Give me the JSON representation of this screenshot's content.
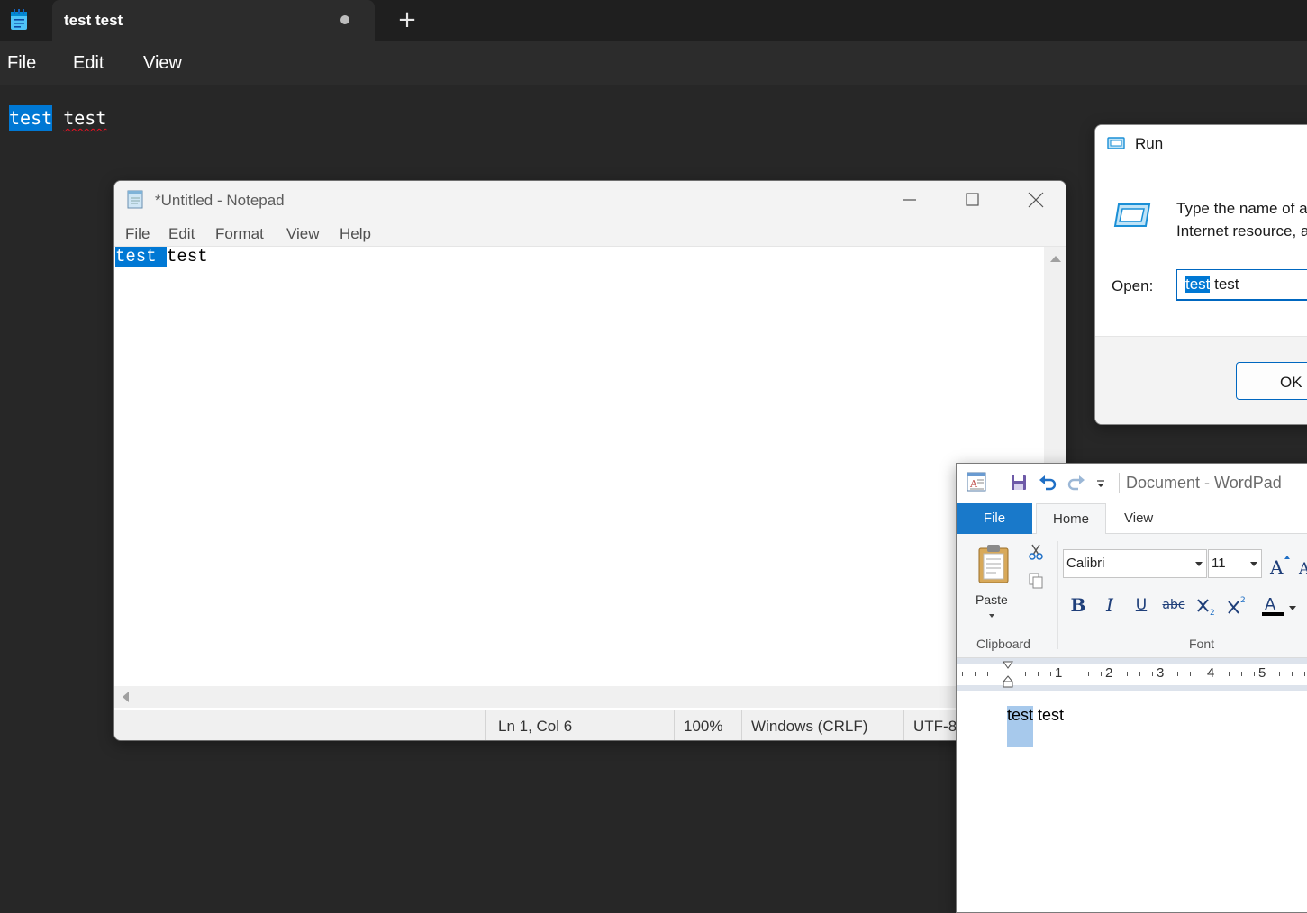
{
  "bg_notepad": {
    "tab_title": "test test",
    "menu": [
      "File",
      "Edit",
      "View"
    ],
    "text_selected": "test",
    "text_rest": "test"
  },
  "notepad": {
    "title": "*Untitled - Notepad",
    "menu": [
      "File",
      "Edit",
      "Format",
      "View",
      "Help"
    ],
    "text_selected": "test ",
    "text_rest": "test",
    "status": {
      "position": "Ln 1, Col 6",
      "zoom": "100%",
      "line_ending": "Windows (CRLF)",
      "encoding": "UTF-8"
    }
  },
  "run": {
    "title": "Run",
    "desc_line1": "Type the name of a",
    "desc_line2": "Internet resource, a",
    "open_label": "Open:",
    "input_selected": "test",
    "input_rest": " test",
    "ok_label": "OK"
  },
  "wordpad": {
    "title": "Document - WordPad",
    "tabs": {
      "file": "File",
      "home": "Home",
      "view": "View"
    },
    "paste_label": "Paste",
    "clipboard_label": "Clipboard",
    "font_label": "Font",
    "font_name": "Calibri",
    "font_size": "11",
    "ruler_numbers": [
      "1",
      "2",
      "3",
      "4",
      "5"
    ],
    "text_selected": "test",
    "text_rest": " test"
  },
  "colors": {
    "selection": "#0078d4",
    "wordpad_selection": "#a7c9ec",
    "wordpad_file_tab": "#1979ca"
  }
}
